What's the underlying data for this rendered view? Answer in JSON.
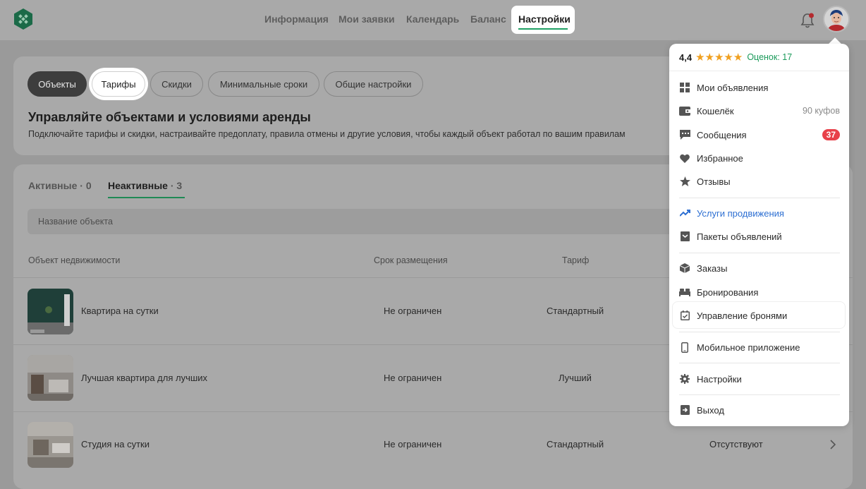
{
  "header": {
    "nav": [
      {
        "label": "Информация"
      },
      {
        "label": "Мои заявки"
      },
      {
        "label": "Календарь"
      },
      {
        "label": "Баланс"
      },
      {
        "label": "Настройки",
        "active": true
      }
    ],
    "notification_dot": true
  },
  "pills": [
    {
      "label": "Объекты",
      "state": "selected"
    },
    {
      "label": "Тарифы",
      "state": "highlighted"
    },
    {
      "label": "Скидки"
    },
    {
      "label": "Минимальные сроки"
    },
    {
      "label": "Общие настройки"
    }
  ],
  "intro": {
    "title": "Управляйте объектами и условиями аренды",
    "subtitle": "Подключайте тарифы и скидки, настраивайте предоплату, правила отмены и другие условия, чтобы каждый объект работал по вашим правилам"
  },
  "tabs": [
    {
      "label": "Активные",
      "count": "· 0"
    },
    {
      "label": "Неактивные",
      "count": "· 3",
      "active": true
    }
  ],
  "search": {
    "placeholder": "Название объекта"
  },
  "table": {
    "headers": [
      "Объект недвижимости",
      "Срок размещения",
      "Тариф"
    ],
    "rows": [
      {
        "name": "Квартира на сутки",
        "term": "Не ограничен",
        "tariff": "Стандартный",
        "extra": ""
      },
      {
        "name": "Лучшая квартира для лучших",
        "term": "Не ограничен",
        "tariff": "Лучший",
        "extra": ""
      },
      {
        "name": "Студия на сутки",
        "term": "Не ограничен",
        "tariff": "Стандартный",
        "extra": "Отсутствуют"
      }
    ]
  },
  "dropdown": {
    "rating": {
      "value": "4,4",
      "stars": "★★★★★",
      "count_text": "Оценок: 17"
    },
    "items": [
      {
        "label": "Мои объявления",
        "icon": "grid-icon"
      },
      {
        "label": "Кошелёк",
        "icon": "wallet-icon",
        "value": "90 куфов"
      },
      {
        "label": "Сообщения",
        "icon": "chat-icon",
        "badge": "37"
      },
      {
        "label": "Избранное",
        "icon": "heart-icon"
      },
      {
        "label": "Отзывы",
        "icon": "star-icon"
      },
      {
        "label": "Услуги продвижения",
        "icon": "trend-up-icon",
        "accent": "#2d6fd2"
      },
      {
        "label": "Пакеты объявлений",
        "icon": "package-icon"
      },
      {
        "label": "Заказы",
        "icon": "box-icon"
      },
      {
        "label": "Бронирования",
        "icon": "bed-icon"
      },
      {
        "label": "Управление бронями",
        "icon": "calendar-check-icon",
        "highlighted": true
      },
      {
        "label": "Мобильное приложение",
        "icon": "phone-icon"
      },
      {
        "label": "Настройки",
        "icon": "gear-icon"
      },
      {
        "label": "Выход",
        "icon": "logout-icon"
      }
    ]
  },
  "colors": {
    "brand_green": "#1fa064",
    "badge_red": "#e8414a",
    "promo_blue": "#2d6fd2",
    "star": "#f0a020"
  }
}
